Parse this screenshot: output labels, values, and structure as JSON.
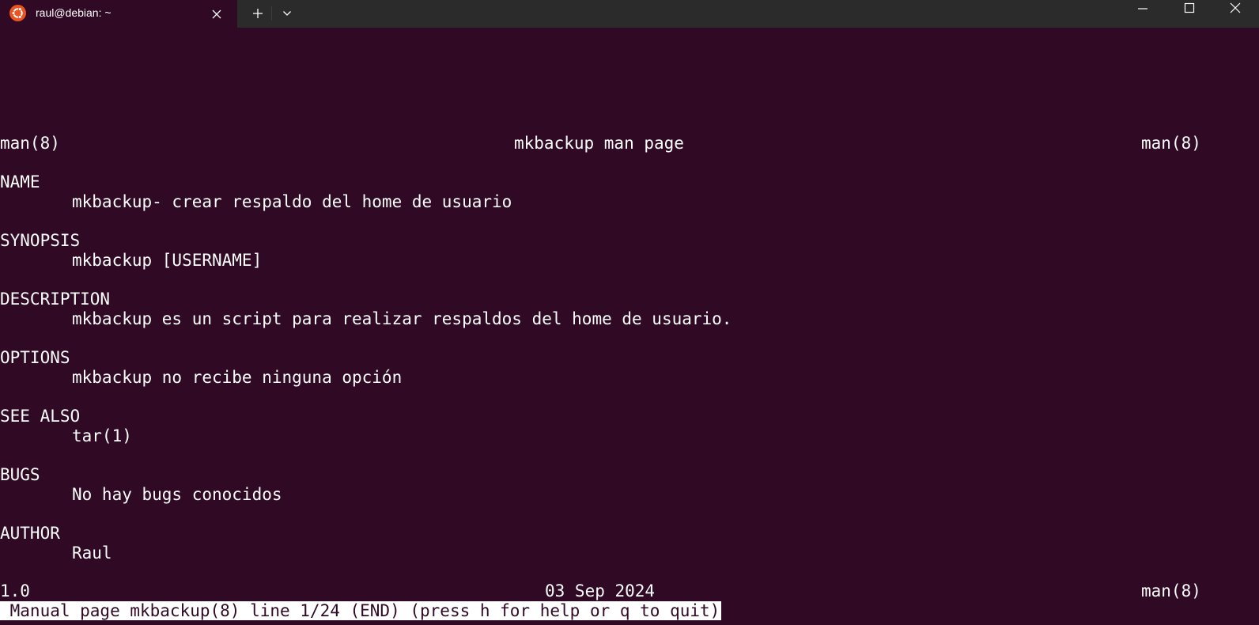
{
  "tab": {
    "title": "raul@debian: ~",
    "icon": "ubuntu-icon"
  },
  "titlebar": {
    "new_tab_icon": "plus-icon",
    "dropdown_icon": "chevron-down-icon",
    "minimize_icon": "minimize-icon",
    "maximize_icon": "maximize-icon",
    "close_icon": "close-icon"
  },
  "colors": {
    "terminal_bg": "#300a24",
    "titlebar_bg": "#2b2b2b",
    "ubuntu_orange": "#e95420",
    "text": "#ffffff"
  },
  "man": {
    "header_left": "man(8)",
    "header_center": "mkbackup man page",
    "header_right": "man(8)",
    "sections": [
      {
        "heading": "NAME",
        "body": "mkbackup- crear respaldo del home de usuario"
      },
      {
        "heading": "SYNOPSIS",
        "body": "mkbackup [USERNAME]"
      },
      {
        "heading": "DESCRIPTION",
        "body": "mkbackup es un script para realizar respaldos del home de usuario."
      },
      {
        "heading": "OPTIONS",
        "body": "mkbackup no recibe ninguna opción"
      },
      {
        "heading": "SEE ALSO",
        "body": "tar(1)"
      },
      {
        "heading": "BUGS",
        "body": "No hay bugs conocidos"
      },
      {
        "heading": "AUTHOR",
        "body": "Raul"
      }
    ],
    "footer_left": "1.0",
    "footer_center": "03 Sep 2024",
    "footer_right": "man(8)",
    "status": " Manual page mkbackup(8) line 1/24 (END) (press h for help or q to quit)"
  }
}
